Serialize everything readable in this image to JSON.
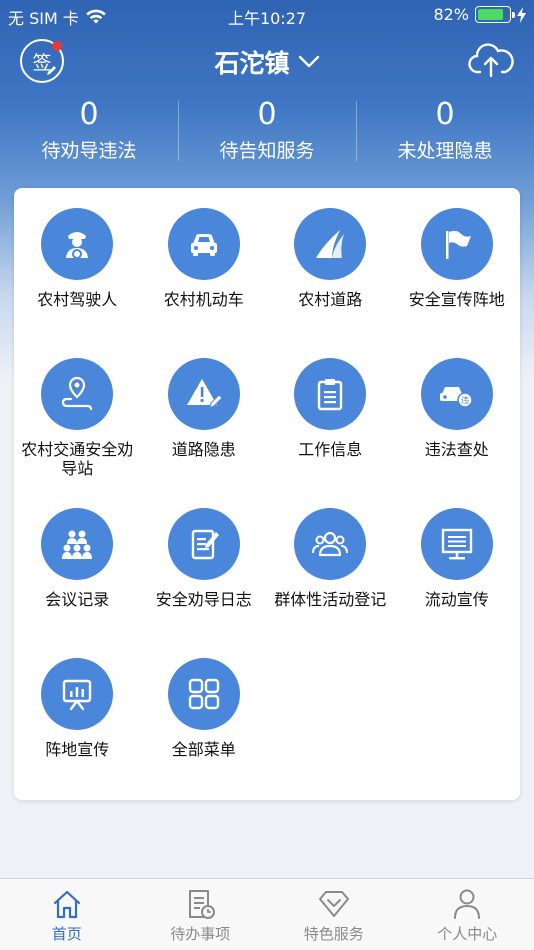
{
  "status_bar": {
    "carrier": "无 SIM 卡",
    "time": "上午10:27",
    "battery": "82%"
  },
  "nav": {
    "sign_label": "签",
    "title": "石沱镇"
  },
  "stats": [
    {
      "value": "0",
      "label": "待劝导违法"
    },
    {
      "value": "0",
      "label": "待告知服务"
    },
    {
      "value": "0",
      "label": "未处理隐患"
    }
  ],
  "menu": [
    {
      "label": "农村驾驶人",
      "icon": "driver-icon"
    },
    {
      "label": "农村机动车",
      "icon": "car-icon"
    },
    {
      "label": "农村道路",
      "icon": "road-icon"
    },
    {
      "label": "安全宣传阵地",
      "icon": "flag-icon"
    },
    {
      "label": "农村交通安全劝导站",
      "icon": "route-location-icon"
    },
    {
      "label": "道路隐患",
      "icon": "hazard-warning-icon"
    },
    {
      "label": "工作信息",
      "icon": "clipboard-icon"
    },
    {
      "label": "违法查处",
      "icon": "violation-car-icon"
    },
    {
      "label": "会议记录",
      "icon": "meeting-people-icon"
    },
    {
      "label": "安全劝导日志",
      "icon": "log-edit-icon"
    },
    {
      "label": "群体性活动登记",
      "icon": "group-icon"
    },
    {
      "label": "流动宣传",
      "icon": "presentation-board-icon"
    },
    {
      "label": "阵地宣传",
      "icon": "easel-chart-icon"
    },
    {
      "label": "全部菜单",
      "icon": "grid-menu-icon"
    }
  ],
  "tabs": [
    {
      "label": "首页",
      "icon": "home-icon",
      "active": true
    },
    {
      "label": "待办事项",
      "icon": "todo-document-icon",
      "active": false
    },
    {
      "label": "特色服务",
      "icon": "diamond-icon",
      "active": false
    },
    {
      "label": "个人中心",
      "icon": "person-icon",
      "active": false
    }
  ],
  "colors": {
    "accent": "#4a86d9",
    "header_top": "#2f63b3",
    "active_tab": "#2f6fc7",
    "notification_dot": "#e53935",
    "battery": "#4cd964"
  }
}
